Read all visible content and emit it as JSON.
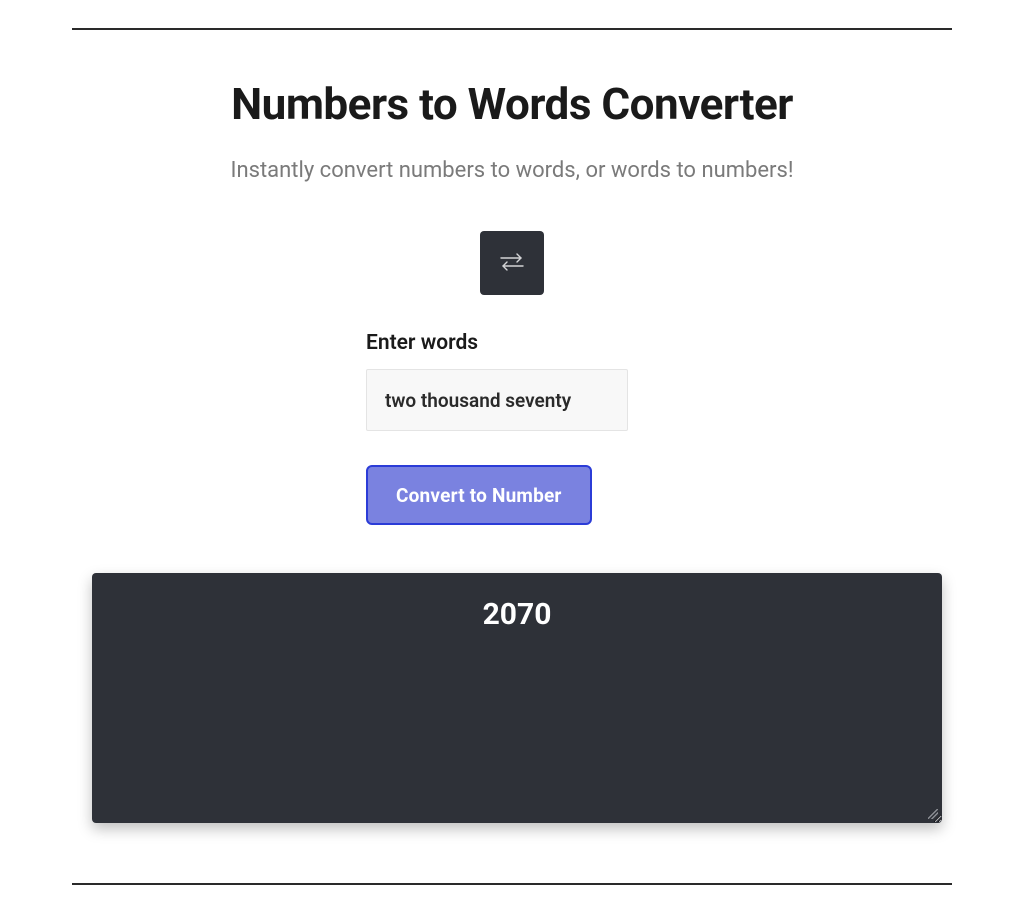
{
  "header": {
    "title": "Numbers to Words Converter",
    "subtitle": "Instantly convert numbers to words, or words to numbers!"
  },
  "form": {
    "input_label": "Enter words",
    "input_value": "two thousand seventy",
    "convert_label": "Convert to Number"
  },
  "output": {
    "result": "2070"
  },
  "colors": {
    "dark": "#2e3138",
    "accent": "#7a82e0",
    "accent_border": "#2b3cd7"
  }
}
